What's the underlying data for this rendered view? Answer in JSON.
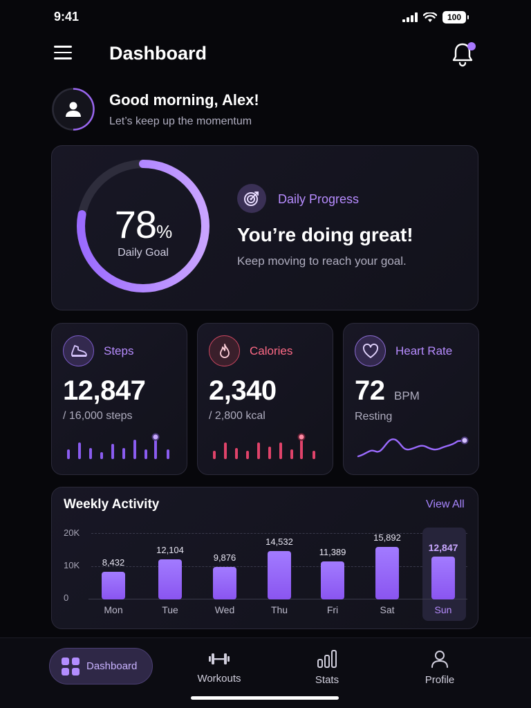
{
  "status": {
    "time": "9:41",
    "battery": "100"
  },
  "header": {
    "title": "Dashboard"
  },
  "greeting": {
    "title": "Good morning, Alex!",
    "subtitle": "Let’s keep up the momentum"
  },
  "progress": {
    "percent": "78",
    "percent_value": 78,
    "percent_sign": "%",
    "label": "Daily Goal",
    "section_label": "Daily Progress",
    "headline": "You’re doing great!",
    "message": "Keep moving to reach your goal."
  },
  "metrics": {
    "steps": {
      "title": "Steps",
      "value": "12,847",
      "sub": "/ 16,000 steps",
      "color": "#9b6bff"
    },
    "calories": {
      "title": "Calories",
      "value": "2,340",
      "sub": "/ 2,800 kcal",
      "color": "#ff5a7a"
    },
    "heart": {
      "title": "Heart Rate",
      "value": "72",
      "unit": "BPM",
      "sub": "Resting",
      "color": "#b68cff"
    }
  },
  "weekly": {
    "title": "Weekly Activity",
    "view_all": "View All",
    "y_ticks": [
      "20K",
      "10K",
      "0"
    ],
    "days": [
      {
        "day": "Mon",
        "value": 8432,
        "label": "8,432"
      },
      {
        "day": "Tue",
        "value": 12104,
        "label": "12,104"
      },
      {
        "day": "Wed",
        "value": 9876,
        "label": "9,876"
      },
      {
        "day": "Thu",
        "value": 14532,
        "label": "14,532"
      },
      {
        "day": "Fri",
        "value": 11389,
        "label": "11,389"
      },
      {
        "day": "Sat",
        "value": 15892,
        "label": "15,892"
      },
      {
        "day": "Sun",
        "value": 12847,
        "label": "12,847"
      }
    ],
    "highlight_day": "Sun",
    "accent": "#9b6bff"
  },
  "nav": {
    "dashboard": "Dashboard",
    "workouts": "Workouts",
    "stats": "Stats",
    "profile": "Profile"
  }
}
